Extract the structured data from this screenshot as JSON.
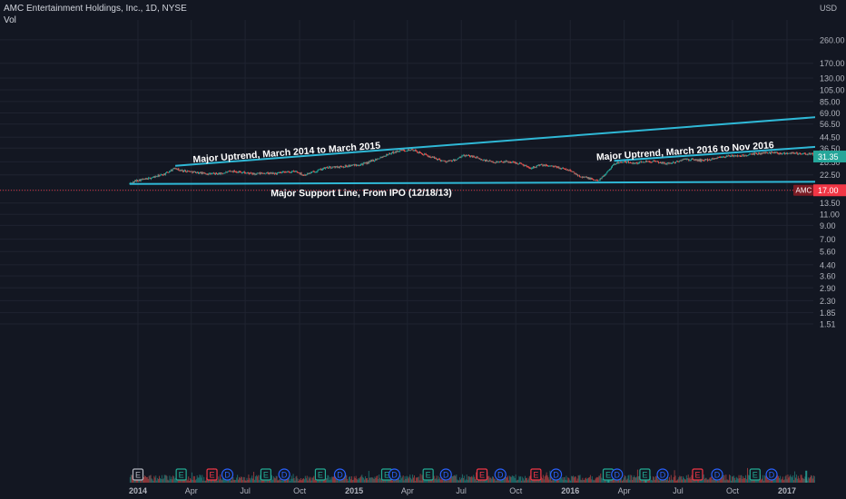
{
  "header": {
    "symbol_line": "AMC Entertainment Holdings, Inc., 1D, NYSE",
    "volume_label": "Vol"
  },
  "chart_data": {
    "type": "candlestick",
    "symbol": "AMC",
    "exchange": "NYSE",
    "interval": "1D",
    "currency": "USD",
    "y_scale": "log",
    "ylim": [
      1.4,
      300
    ],
    "y_ticks": [
      260.0,
      170.0,
      130.0,
      105.0,
      85.0,
      69.0,
      56.5,
      44.5,
      36.5,
      28.5,
      22.5,
      17.0,
      13.5,
      11.0,
      9.0,
      7.0,
      5.6,
      4.4,
      3.6,
      2.9,
      2.3,
      1.85,
      1.51
    ],
    "y_tick_labels": [
      "260.00",
      "170.00",
      "130.00",
      "105.00",
      "85.00",
      "69.00",
      "56.50",
      "44.50",
      "36.50",
      "28.50",
      "22.50",
      "13.50",
      "11.00",
      "9.00",
      "7.00",
      "5.60",
      "4.40",
      "3.60",
      "2.90",
      "2.30",
      "1.85",
      "1.51"
    ],
    "x_range": [
      "2013-12-18",
      "2017-03-10"
    ],
    "x_tick_labels": [
      {
        "date": "2014-01-01",
        "label": "2014",
        "bold": true
      },
      {
        "date": "2014-04-01",
        "label": "Apr",
        "bold": false
      },
      {
        "date": "2014-07-01",
        "label": "Jul",
        "bold": false
      },
      {
        "date": "2014-10-01",
        "label": "Oct",
        "bold": false
      },
      {
        "date": "2015-01-01",
        "label": "2015",
        "bold": true
      },
      {
        "date": "2015-04-01",
        "label": "Apr",
        "bold": false
      },
      {
        "date": "2015-07-01",
        "label": "Jul",
        "bold": false
      },
      {
        "date": "2015-10-01",
        "label": "Oct",
        "bold": false
      },
      {
        "date": "2016-01-01",
        "label": "2016",
        "bold": true
      },
      {
        "date": "2016-04-01",
        "label": "Apr",
        "bold": false
      },
      {
        "date": "2016-07-01",
        "label": "Jul",
        "bold": false
      },
      {
        "date": "2016-10-01",
        "label": "Oct",
        "bold": false
      },
      {
        "date": "2017-01-01",
        "label": "2017",
        "bold": true
      }
    ],
    "price_path": [
      [
        "2013-12-18",
        19.2
      ],
      [
        "2013-12-31",
        20.4
      ],
      [
        "2014-01-15",
        20.8
      ],
      [
        "2014-02-01",
        21.9
      ],
      [
        "2014-02-15",
        22.8
      ],
      [
        "2014-03-05",
        25.6
      ],
      [
        "2014-03-12",
        24.4
      ],
      [
        "2014-03-25",
        24.1
      ],
      [
        "2014-04-15",
        23.3
      ],
      [
        "2014-05-01",
        22.9
      ],
      [
        "2014-05-20",
        23.0
      ],
      [
        "2014-06-10",
        24.1
      ],
      [
        "2014-06-25",
        23.6
      ],
      [
        "2014-07-15",
        22.8
      ],
      [
        "2014-08-01",
        23.2
      ],
      [
        "2014-08-20",
        23.0
      ],
      [
        "2014-09-10",
        23.7
      ],
      [
        "2014-09-25",
        23.9
      ],
      [
        "2014-10-08",
        22.4
      ],
      [
        "2014-10-25",
        23.8
      ],
      [
        "2014-11-15",
        25.6
      ],
      [
        "2014-12-10",
        26.1
      ],
      [
        "2014-12-31",
        26.8
      ],
      [
        "2015-01-20",
        27.6
      ],
      [
        "2015-02-10",
        30.3
      ],
      [
        "2015-03-05",
        33.5
      ],
      [
        "2015-03-20",
        35.1
      ],
      [
        "2015-04-10",
        35.4
      ],
      [
        "2015-04-25",
        33.0
      ],
      [
        "2015-05-15",
        30.6
      ],
      [
        "2015-06-05",
        28.6
      ],
      [
        "2015-06-20",
        29.3
      ],
      [
        "2015-07-05",
        31.9
      ],
      [
        "2015-07-20",
        31.6
      ],
      [
        "2015-08-05",
        29.5
      ],
      [
        "2015-08-25",
        28.3
      ],
      [
        "2015-09-10",
        28.7
      ],
      [
        "2015-09-25",
        28.3
      ],
      [
        "2015-10-10",
        27.5
      ],
      [
        "2015-10-25",
        25.5
      ],
      [
        "2015-11-10",
        26.8
      ],
      [
        "2015-11-25",
        26.6
      ],
      [
        "2015-12-10",
        25.8
      ],
      [
        "2015-12-31",
        24.4
      ],
      [
        "2016-01-15",
        22.2
      ],
      [
        "2016-02-05",
        20.9
      ],
      [
        "2016-02-15",
        20.2
      ],
      [
        "2016-02-25",
        21.7
      ],
      [
        "2016-03-10",
        26.0
      ],
      [
        "2016-03-20",
        28.2
      ],
      [
        "2016-04-05",
        28.3
      ],
      [
        "2016-04-20",
        27.8
      ],
      [
        "2016-05-10",
        28.9
      ],
      [
        "2016-05-25",
        28.5
      ],
      [
        "2016-06-10",
        27.6
      ],
      [
        "2016-06-25",
        28.1
      ],
      [
        "2016-07-10",
        29.8
      ],
      [
        "2016-07-25",
        29.6
      ],
      [
        "2016-08-10",
        29.2
      ],
      [
        "2016-08-25",
        29.8
      ],
      [
        "2016-09-10",
        31.1
      ],
      [
        "2016-09-25",
        31.6
      ],
      [
        "2016-10-10",
        31.7
      ],
      [
        "2016-10-25",
        32.1
      ],
      [
        "2016-11-10",
        33.0
      ],
      [
        "2016-11-25",
        33.5
      ],
      [
        "2016-12-10",
        33.8
      ],
      [
        "2016-12-25",
        33.2
      ],
      [
        "2017-01-10",
        33.6
      ],
      [
        "2017-01-25",
        32.8
      ],
      [
        "2017-02-10",
        32.9
      ],
      [
        "2017-02-25",
        31.9
      ],
      [
        "2017-03-05",
        31.4
      ],
      [
        "2017-03-10",
        31.35
      ]
    ],
    "last_price": {
      "value": 31.35,
      "label": "31.35"
    },
    "alert_line": {
      "value": 17.0,
      "tag": "AMC",
      "label": "17.00"
    },
    "trendlines": [
      {
        "label": "Major Uptrend, March 2014 to March 2015",
        "from": [
          "2014-03-05",
          26.5
        ],
        "to": [
          "2017-03-10",
          65.0
        ]
      },
      {
        "label": "Major Uptrend, March 2016 to Nov 2016",
        "from": [
          "2016-03-15",
          29.0
        ],
        "to": [
          "2017-03-10",
          37.9
        ]
      },
      {
        "label": "Major Support Line, From IPO (12/18/13)",
        "from": [
          "2013-12-18",
          19.05
        ],
        "to": [
          "2017-03-10",
          19.85
        ]
      }
    ],
    "volume_spikes": [
      {
        "date": "2016-03-04",
        "level": 0.12
      },
      {
        "date": "2016-05-06",
        "level": 0.08
      },
      {
        "date": "2017-02-01",
        "level": 0.12
      },
      {
        "date": "2017-02-27",
        "level": 0.35
      },
      {
        "date": "2017-03-07",
        "level": 1.0
      }
    ],
    "events": [
      {
        "date": "2014-01-01",
        "type": "E",
        "color": "#b2b5be"
      },
      {
        "date": "2014-03-15",
        "type": "E",
        "color": "#22ab94"
      },
      {
        "date": "2014-05-06",
        "type": "E",
        "color": "#f23645"
      },
      {
        "date": "2014-06-01",
        "type": "D",
        "color": "#2962ff"
      },
      {
        "date": "2014-08-05",
        "type": "E",
        "color": "#22ab94"
      },
      {
        "date": "2014-09-05",
        "type": "D",
        "color": "#2962ff"
      },
      {
        "date": "2014-11-05",
        "type": "E",
        "color": "#22ab94"
      },
      {
        "date": "2014-12-08",
        "type": "D",
        "color": "#2962ff"
      },
      {
        "date": "2015-02-25",
        "type": "E",
        "color": "#22ab94"
      },
      {
        "date": "2015-03-10",
        "type": "D",
        "color": "#2962ff"
      },
      {
        "date": "2015-05-06",
        "type": "E",
        "color": "#22ab94"
      },
      {
        "date": "2015-06-05",
        "type": "D",
        "color": "#2962ff"
      },
      {
        "date": "2015-08-05",
        "type": "E",
        "color": "#f23645"
      },
      {
        "date": "2015-09-05",
        "type": "D",
        "color": "#2962ff"
      },
      {
        "date": "2015-11-04",
        "type": "E",
        "color": "#f23645"
      },
      {
        "date": "2015-12-08",
        "type": "D",
        "color": "#2962ff"
      },
      {
        "date": "2016-03-05",
        "type": "E",
        "color": "#22ab94"
      },
      {
        "date": "2016-03-20",
        "type": "D",
        "color": "#2962ff"
      },
      {
        "date": "2016-05-06",
        "type": "E",
        "color": "#22ab94"
      },
      {
        "date": "2016-06-05",
        "type": "D",
        "color": "#2962ff"
      },
      {
        "date": "2016-08-03",
        "type": "E",
        "color": "#f23645"
      },
      {
        "date": "2016-09-05",
        "type": "D",
        "color": "#2962ff"
      },
      {
        "date": "2016-11-08",
        "type": "E",
        "color": "#22ab94"
      },
      {
        "date": "2016-12-06",
        "type": "D",
        "color": "#2962ff"
      },
      {
        "date": "2017-03-01",
        "type": "E",
        "color": "#22ab94"
      }
    ]
  },
  "colors": {
    "background": "#131722",
    "grid": "#1f2330",
    "text": "#b2b5be",
    "up": "#26a69a",
    "down": "#ef5350",
    "trendline": "#2fb8d6",
    "last_price_tag": "#26a69a",
    "alert": "#f23645"
  }
}
